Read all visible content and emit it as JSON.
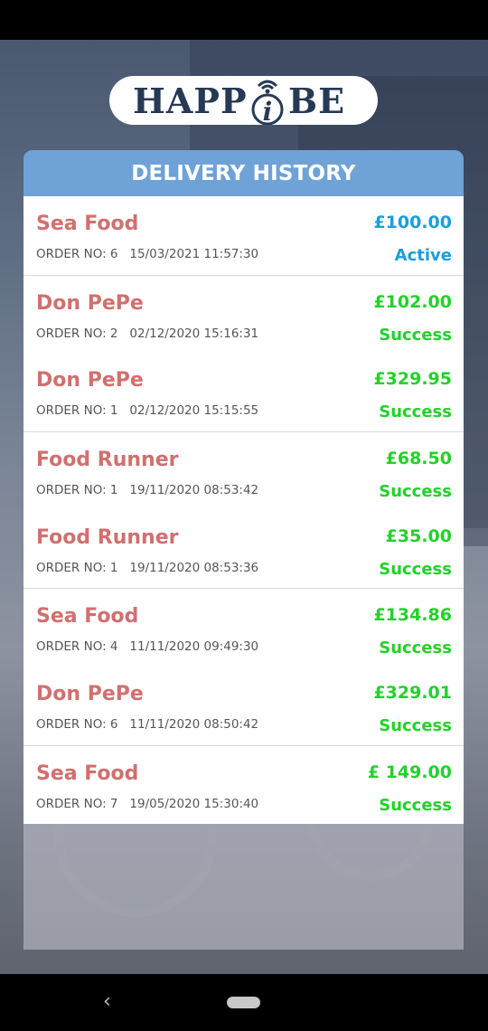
{
  "app": {
    "logo_left": "HAPP",
    "logo_right": "BE"
  },
  "header": {
    "title": "DELIVERY HISTORY"
  },
  "orders": [
    {
      "restaurant": "Sea Food",
      "order_no": "ORDER NO: 6",
      "datetime": "15/03/2021 11:57:30",
      "amount": "£100.00",
      "status": "Active"
    },
    {
      "restaurant": "Don PePe",
      "order_no": "ORDER NO: 2",
      "datetime": "02/12/2020 15:16:31",
      "amount": "£102.00",
      "status": "Success"
    },
    {
      "restaurant": "Don PePe",
      "order_no": "ORDER NO: 1",
      "datetime": "02/12/2020 15:15:55",
      "amount": "£329.95",
      "status": "Success"
    },
    {
      "restaurant": "Food Runner",
      "order_no": "ORDER NO: 1",
      "datetime": "19/11/2020 08:53:42",
      "amount": "£68.50",
      "status": "Success"
    },
    {
      "restaurant": "Food Runner",
      "order_no": "ORDER NO: 1",
      "datetime": "19/11/2020 08:53:36",
      "amount": "£35.00",
      "status": "Success"
    },
    {
      "restaurant": "Sea Food",
      "order_no": "ORDER NO: 4",
      "datetime": "11/11/2020 09:49:30",
      "amount": "£134.86",
      "status": "Success"
    },
    {
      "restaurant": "Don PePe",
      "order_no": "ORDER NO: 6",
      "datetime": "11/11/2020 08:50:42",
      "amount": "£329.01",
      "status": "Success"
    },
    {
      "restaurant": "Sea Food",
      "order_no": "ORDER NO: 7",
      "datetime": "19/05/2020 15:30:40",
      "amount": "£ 149.00",
      "status": "Success"
    }
  ],
  "colors": {
    "header": "#6fa2d6",
    "restaurant_name": "#d0706f",
    "success": "#23d12a",
    "active": "#1a9fdc"
  },
  "nav": {
    "back_icon": "back-arrow-icon",
    "home_icon": "home-pill-icon"
  }
}
